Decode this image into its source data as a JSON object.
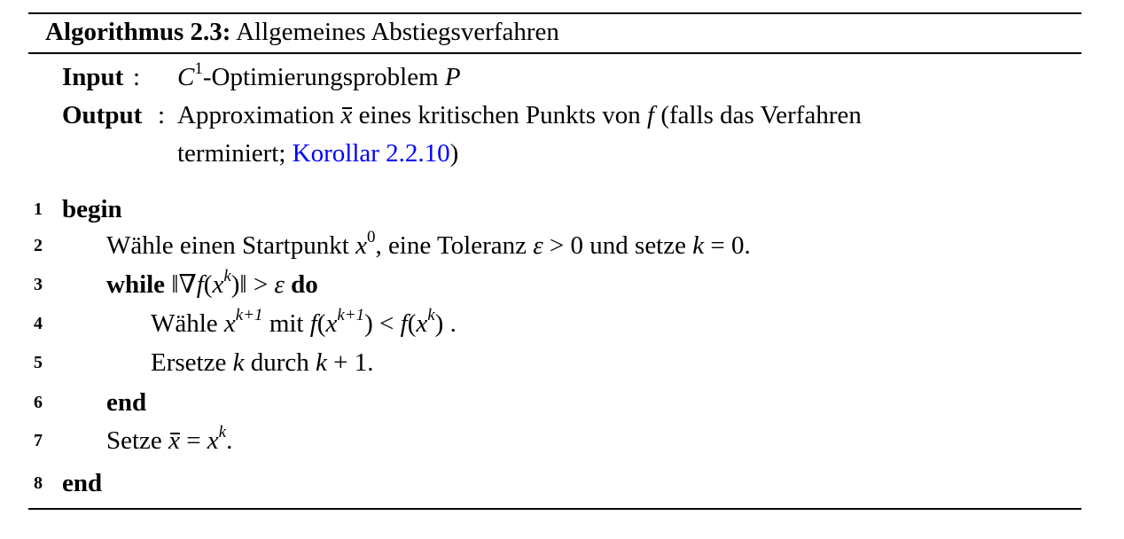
{
  "algorithm": {
    "label": "Algorithmus 2.3:",
    "title": "Allgemeines Abstiegsverfahren"
  },
  "io": {
    "input_label": "Input",
    "input_colon": ":",
    "input_c": "C",
    "input_c_sup": "1",
    "input_text": "-Optimierungsproblem ",
    "input_p": "P",
    "output_label": "Output",
    "output_colon": ":",
    "output_text1": "Approximation ",
    "output_xbar": "x",
    "output_text2": " eines kritischen Punkts von ",
    "output_f": "f",
    "output_text3": " (falls das Verfahren",
    "output_line2_text": "terminiert; ",
    "output_link": "Korollar 2.2.10",
    "output_line2_end": ")"
  },
  "lines": [
    {
      "num": "1"
    },
    {
      "num": "2"
    },
    {
      "num": "3"
    },
    {
      "num": "4"
    },
    {
      "num": "5"
    },
    {
      "num": "6"
    },
    {
      "num": "7"
    },
    {
      "num": "8"
    }
  ],
  "code": {
    "l1_kw": "begin",
    "l2_a": "Wähle einen Startpunkt ",
    "l2_x": "x",
    "l2_x_sup": "0",
    "l2_b": ", eine Toleranz ",
    "l2_eps": "ε",
    "l2_c": " > 0 und setze ",
    "l2_k": "k",
    "l2_d": " = 0.",
    "l3_kw": "while",
    "l3_expr_a": " ‖∇",
    "l3_f": "f",
    "l3_expr_b": "(",
    "l3_x": "x",
    "l3_x_sup": "k",
    "l3_expr_c": ")‖ > ",
    "l3_eps": "ε",
    "l3_kw2": " do",
    "l4_a": "Wähle ",
    "l4_x": "x",
    "l4_x_sup": "k+1",
    "l4_b": " mit  ",
    "l4_f1": "f",
    "l4_c": "(",
    "l4_x2": "x",
    "l4_x2_sup": "k+1",
    "l4_d": ") < ",
    "l4_f2": "f",
    "l4_e": "(",
    "l4_x3": "x",
    "l4_x3_sup": "k",
    "l4_g": ") .",
    "l5_a": "Ersetze ",
    "l5_k": "k",
    "l5_b": " durch ",
    "l5_k2": "k",
    "l5_c": " + 1.",
    "l6_kw": "end",
    "l7_a": "Setze ",
    "l7_xbar": "x",
    "l7_b": " = ",
    "l7_x": "x",
    "l7_x_sup": "k",
    "l7_c": ".",
    "l8_kw": "end"
  },
  "colors": {
    "link": "#0000ff",
    "text": "#000000",
    "background": "#ffffff"
  }
}
